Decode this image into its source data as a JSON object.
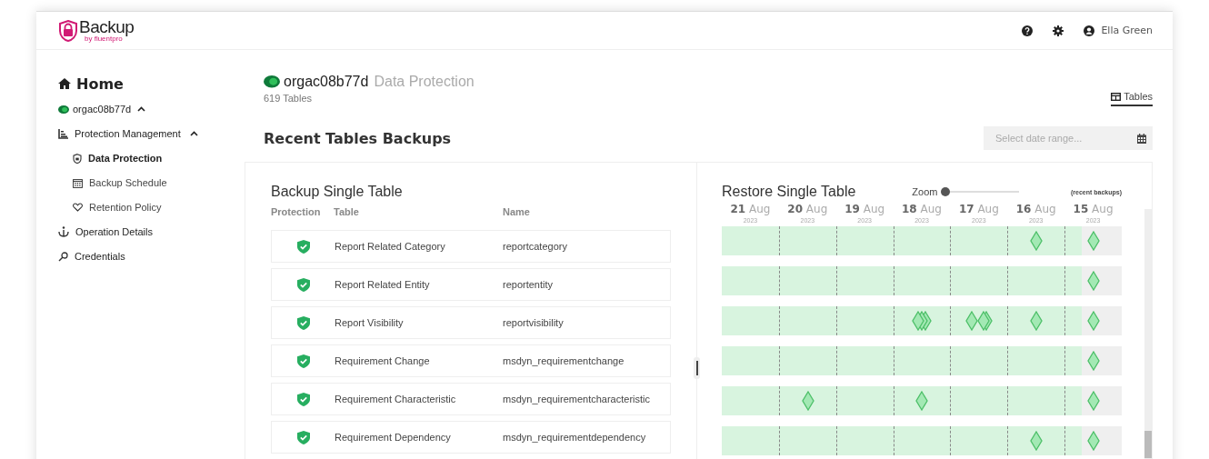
{
  "header": {
    "logo": {
      "name": "Backup",
      "byline": "by fluentpro"
    },
    "user": "Ella Green"
  },
  "sidebar": {
    "home": "Home",
    "organization": {
      "label": "orgac08b77d",
      "expanded": true
    },
    "items": [
      {
        "label": "Protection Management",
        "expanded": true,
        "children": [
          {
            "label": "Data Protection",
            "selected": true
          },
          {
            "label": "Backup Schedule",
            "selected": false
          },
          {
            "label": "Retention Policy",
            "selected": false
          }
        ]
      },
      {
        "label": "Operation Details"
      },
      {
        "label": "Credentials"
      }
    ]
  },
  "page": {
    "org": "orgac08b77d",
    "title": "Data Protection",
    "subtitle": "619 Tables"
  },
  "view_tabs": [
    {
      "label": "Tables",
      "selected": true
    }
  ],
  "section_title": "Recent Tables Backups",
  "date_range": {
    "placeholder": "Select date range..."
  },
  "backup_panel": {
    "title": "Backup Single Table",
    "columns": [
      "Protection",
      "Table",
      "Name"
    ],
    "rows": [
      {
        "table": "Report Related Category",
        "name": "reportcategory",
        "protected": true
      },
      {
        "table": "Report Related Entity",
        "name": "reportentity",
        "protected": true
      },
      {
        "table": "Report Visibility",
        "name": "reportvisibility",
        "protected": true
      },
      {
        "table": "Requirement Change",
        "name": "msdyn_requirementchange",
        "protected": true
      },
      {
        "table": "Requirement Characteristic",
        "name": "msdyn_requirementcharacteristic",
        "protected": true
      },
      {
        "table": "Requirement Dependency",
        "name": "msdyn_requirementdependency",
        "protected": true
      }
    ]
  },
  "restore_panel": {
    "title": "Restore Single Table",
    "zoom": {
      "label": "Zoom",
      "level": 0
    },
    "note": "(recent backups)",
    "days": [
      {
        "day": "21",
        "month": "Aug",
        "year": "2023"
      },
      {
        "day": "20",
        "month": "Aug",
        "year": "2023"
      },
      {
        "day": "19",
        "month": "Aug",
        "year": "2023"
      },
      {
        "day": "18",
        "month": "Aug",
        "year": "2023"
      },
      {
        "day": "17",
        "month": "Aug",
        "year": "2023"
      },
      {
        "day": "16",
        "month": "Aug",
        "year": "2023"
      },
      {
        "day": "15",
        "month": "Aug",
        "year": "2023"
      }
    ],
    "rows": [
      {
        "cells": [
          {
            "kind": "empty"
          },
          {
            "kind": "empty"
          },
          {
            "kind": "empty"
          },
          {
            "kind": "empty"
          },
          {
            "kind": "empty"
          },
          {
            "kind": "single"
          },
          {
            "kind": "single"
          }
        ]
      },
      {
        "cells": [
          {
            "kind": "empty"
          },
          {
            "kind": "empty"
          },
          {
            "kind": "empty"
          },
          {
            "kind": "empty"
          },
          {
            "kind": "empty"
          },
          {
            "kind": "empty"
          },
          {
            "kind": "single"
          }
        ]
      },
      {
        "cells": [
          {
            "kind": "empty"
          },
          {
            "kind": "empty"
          },
          {
            "kind": "empty"
          },
          {
            "kind": "stacked"
          },
          {
            "kind": "split"
          },
          {
            "kind": "single"
          },
          {
            "kind": "single"
          }
        ]
      },
      {
        "cells": [
          {
            "kind": "empty"
          },
          {
            "kind": "empty"
          },
          {
            "kind": "empty"
          },
          {
            "kind": "empty"
          },
          {
            "kind": "empty"
          },
          {
            "kind": "empty"
          },
          {
            "kind": "single"
          }
        ]
      },
      {
        "cells": [
          {
            "kind": "empty"
          },
          {
            "kind": "single"
          },
          {
            "kind": "empty"
          },
          {
            "kind": "single"
          },
          {
            "kind": "empty"
          },
          {
            "kind": "empty"
          },
          {
            "kind": "single"
          }
        ]
      },
      {
        "cells": [
          {
            "kind": "empty"
          },
          {
            "kind": "empty"
          },
          {
            "kind": "empty"
          },
          {
            "kind": "empty"
          },
          {
            "kind": "empty"
          },
          {
            "kind": "single"
          },
          {
            "kind": "single"
          }
        ]
      }
    ]
  }
}
